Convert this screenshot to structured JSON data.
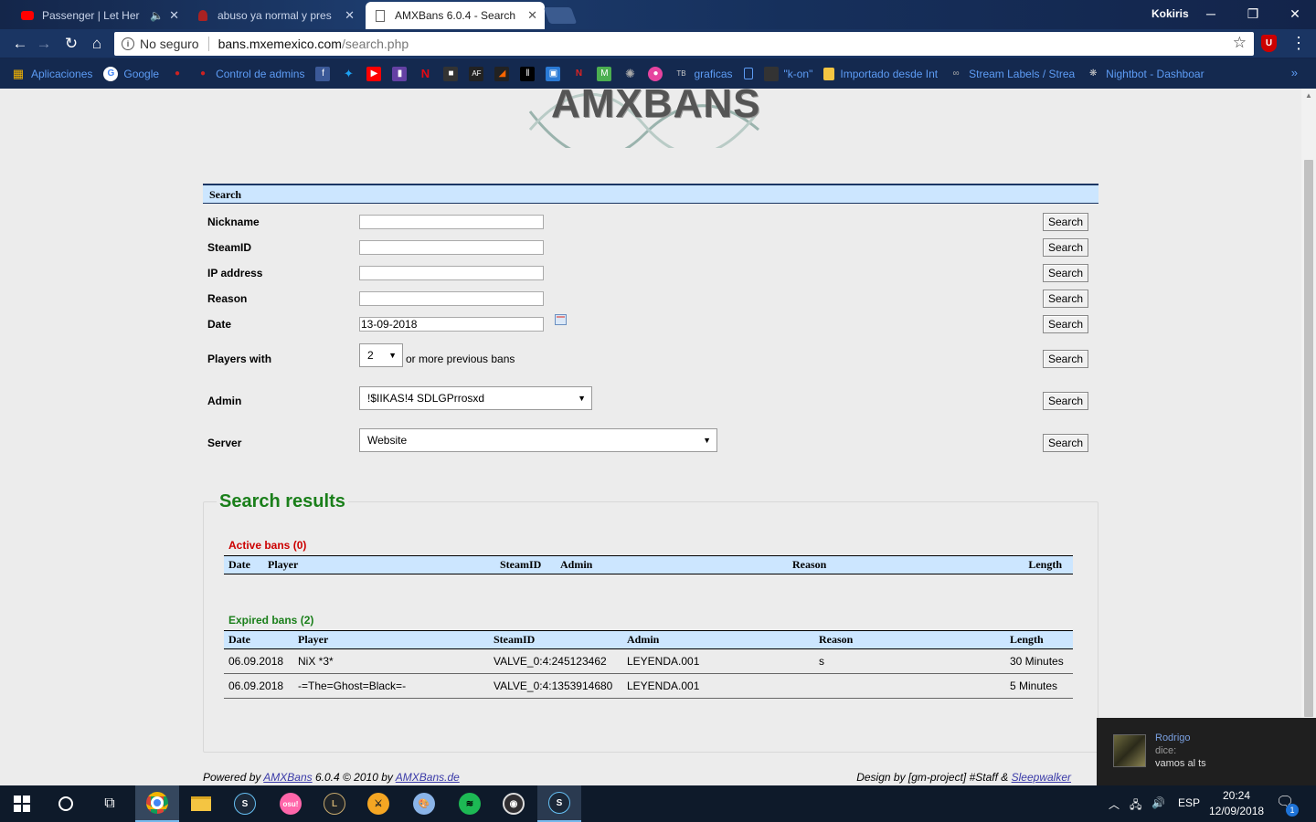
{
  "browser": {
    "tabs": [
      {
        "title": "Passenger | Let Her",
        "icon": "youtube-icon",
        "audio": true
      },
      {
        "title": "abuso ya normal y pres",
        "icon": "amxbans-favicon-icon"
      },
      {
        "title": "AMXBans 6.0.4 - Search",
        "icon": "page-icon",
        "active": true
      }
    ],
    "profile": "Kokiris",
    "security": "No seguro",
    "url_host": "bans.mxemexico.com",
    "url_path": "/search.php",
    "bookmarks": {
      "apps": "Aplicaciones",
      "google": "Google",
      "control": "Control de admins",
      "graficas": "graficas",
      "kon": "\"k-on\"",
      "importado": "Importado desde Int",
      "stream": "Stream Labels / Strea",
      "nightbot": "Nightbot - Dashboar",
      "more": "»"
    },
    "colors": {
      "frame": "#1a3563",
      "bookmark_text": "#5d9cf5"
    }
  },
  "page": {
    "logo": "AMXBANS",
    "search": {
      "header": "Search",
      "button_label": "Search",
      "nickname_label": "Nickname",
      "steamid_label": "SteamID",
      "ip_label": "IP address",
      "reason_label": "Reason",
      "date_label": "Date",
      "date_value": "13-09-2018",
      "players_label": "Players with",
      "players_value": "2",
      "players_suffix": "or more previous bans",
      "admin_label": "Admin",
      "admin_value": "!$IIKAS!4 SDLGPrrosxd",
      "server_label": "Server",
      "server_value": "Website"
    },
    "results": {
      "title": "Search results",
      "active_title": "Active bans (0)",
      "expired_title": "Expired bans (2)",
      "active_columns": [
        "Date",
        "Player",
        "SteamID",
        "Admin",
        "Reason",
        "Length"
      ],
      "expired_columns": [
        "Date",
        "Player",
        "SteamID",
        "Admin",
        "Reason",
        "Length"
      ],
      "expired_rows": [
        {
          "date": "06.09.2018",
          "player": "NiX *3*",
          "steamid": "VALVE_0:4:245123462",
          "admin": "LEYENDA.001",
          "reason": "s",
          "length": "30 Minutes"
        },
        {
          "date": "06.09.2018",
          "player": "-=The=Ghost=Black=-",
          "steamid": "VALVE_0:4:1353914680",
          "admin": "LEYENDA.001",
          "reason": "",
          "length": "5 Minutes"
        }
      ],
      "colors": {
        "active": "#cc0000",
        "expired": "#1a7f1a",
        "header_bg": "#cce6ff"
      }
    },
    "footer": {
      "powered": "Powered by",
      "amxbans_link": "AMXBans",
      "version": "6.0.4 © 2010 by",
      "site_link": "AMXBans.de",
      "design": "Design by [gm-project] #Staff &",
      "sleep_link": "Sleepwalker"
    }
  },
  "toast": {
    "name": "Rodrigo",
    "dice": "dice:",
    "message": "vamos al ts"
  },
  "taskbar": {
    "lang": "ESP",
    "time": "20:24",
    "date": "12/09/2018",
    "notifications": "1"
  }
}
